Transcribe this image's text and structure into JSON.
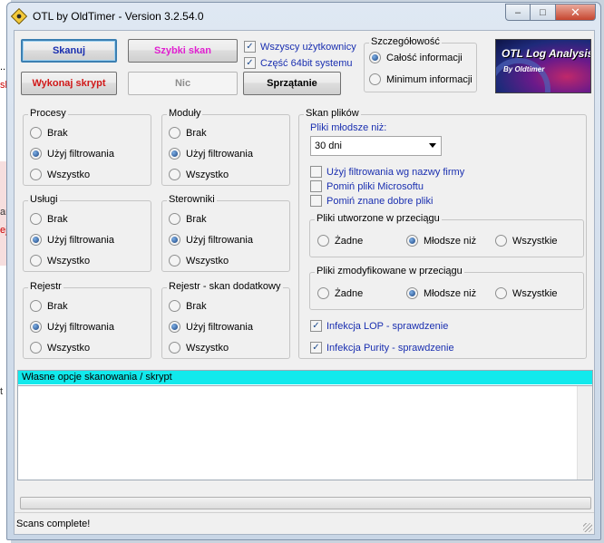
{
  "window": {
    "title": "OTL by OldTimer - Version 3.2.54.0",
    "minimize_glyph": "–",
    "maximize_glyph": "□",
    "close_glyph": "✕"
  },
  "background": {
    "left_fragments": [
      "..",
      "sk",
      "ar",
      "ej",
      "t"
    ]
  },
  "toolbar": {
    "scan_label": "Skanuj",
    "quick_scan_label": "Szybki skan",
    "run_script_label": "Wykonaj skrypt",
    "none_label": "Nic",
    "cleanup_label": "Sprzątanie",
    "all_users_label": "Wszyscy użytkownicy",
    "all_users_checked": true,
    "bit64_label": "Część 64bit systemu",
    "bit64_checked": true
  },
  "detail": {
    "title": "Szczegółowość",
    "options": [
      "Całość informacji",
      "Minimum informacji"
    ],
    "selected": 0
  },
  "logo": {
    "title": "OTL Log Analysis",
    "subtitle": "By Oldtimer"
  },
  "groups": {
    "procesy": {
      "title": "Procesy",
      "options": [
        "Brak",
        "Użyj filtrowania",
        "Wszystko"
      ],
      "selected": 1
    },
    "moduly": {
      "title": "Moduły",
      "options": [
        "Brak",
        "Użyj filtrowania",
        "Wszystko"
      ],
      "selected": 1
    },
    "uslugi": {
      "title": "Usługi",
      "options": [
        "Brak",
        "Użyj filtrowania",
        "Wszystko"
      ],
      "selected": 1
    },
    "sterowniki": {
      "title": "Sterowniki",
      "options": [
        "Brak",
        "Użyj filtrowania",
        "Wszystko"
      ],
      "selected": 1
    },
    "rejestr": {
      "title": "Rejestr",
      "options": [
        "Brak",
        "Użyj filtrowania",
        "Wszystko"
      ],
      "selected": 1
    },
    "rejestr_dodatkowy": {
      "title": "Rejestr - skan dodatkowy",
      "options": [
        "Brak",
        "Użyj filtrowania",
        "Wszystko"
      ],
      "selected": 1
    }
  },
  "file_scan": {
    "title": "Skan plików",
    "younger_than_label": "Pliki młodsze niż:",
    "younger_than_value": "30 dni",
    "checks": [
      {
        "label": "Użyj filtrowania wg nazwy firmy",
        "checked": false
      },
      {
        "label": "Pomiń pliki Microsoftu",
        "checked": false
      },
      {
        "label": "Pomiń znane dobre pliki",
        "checked": false
      }
    ],
    "created": {
      "title": "Pliki utworzone  w przeciągu",
      "options": [
        "Żadne",
        "Młodsze niż",
        "Wszystkie"
      ],
      "selected": 1
    },
    "modified": {
      "title": "Pliki zmodyfikowane w przeciągu",
      "options": [
        "Żadne",
        "Młodsze niż",
        "Wszystkie"
      ],
      "selected": 1
    },
    "lop_label": "Infekcja LOP - sprawdzenie",
    "lop_checked": true,
    "purity_label": "Infekcja Purity - sprawdzenie",
    "purity_checked": true
  },
  "custom_options": {
    "label": "Własne opcje skanowania / skrypt",
    "value": ""
  },
  "status": {
    "text": "Scans complete!",
    "progress": 0
  },
  "colors": {
    "custom_bar": "#12e9ec",
    "run_script": "#d01818",
    "quick_scan": "#e020d0",
    "scan": "#1a2fb0"
  }
}
